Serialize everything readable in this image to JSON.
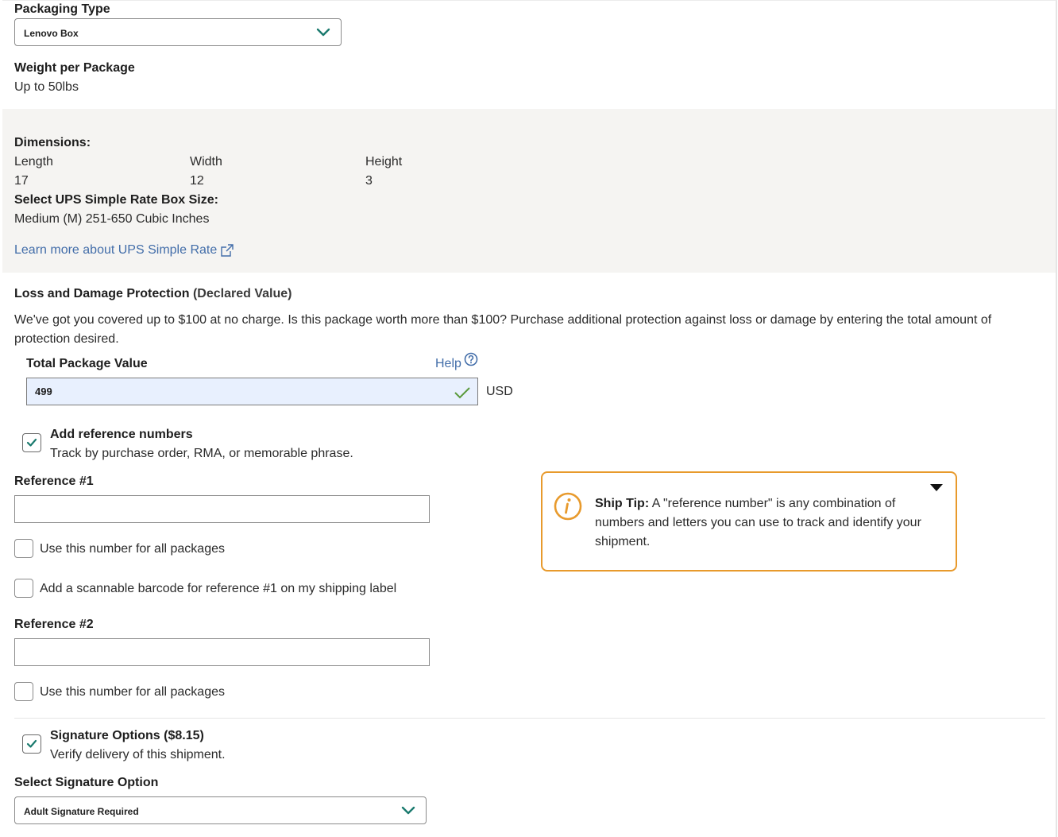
{
  "packaging": {
    "type_label": "Packaging Type",
    "type_value": "Lenovo Box",
    "weight_label": "Weight per Package",
    "weight_value": "Up to 50lbs"
  },
  "dimensions": {
    "title": "Dimensions:",
    "length_label": "Length",
    "length_value": "17",
    "width_label": "Width",
    "width_value": "12",
    "height_label": "Height",
    "height_value": "3",
    "box_size_label": "Select UPS Simple Rate Box Size:",
    "box_size_value": "Medium (M) 251-650 Cubic Inches",
    "learn_more_link": "Learn more about UPS Simple Rate"
  },
  "protection": {
    "title": "Loss and Damage Protection",
    "title_suffix": "(Declared Value)",
    "description": "We've got you covered up to $100 at no charge. Is this package worth more than $100? Purchase additional protection against loss or damage by entering the total amount of protection desired.",
    "value_label": "Total Package Value",
    "help_link": "Help",
    "value": "499",
    "currency": "USD"
  },
  "references": {
    "add_label": "Add reference numbers",
    "add_sublabel": "Track by purchase order, RMA, or memorable phrase.",
    "add_checked": true,
    "ref1_label": "Reference #1",
    "ref1_value": "",
    "ref1_all_packages": "Use this number for all packages",
    "ref1_barcode": "Add a scannable barcode for reference #1 on my shipping label",
    "ref2_label": "Reference #2",
    "ref2_value": "",
    "ref2_all_packages": "Use this number for all packages"
  },
  "ship_tip": {
    "heading": "Ship Tip:",
    "text": "A \"reference number\" is any combination of numbers and letters you can use to track and identify your shipment."
  },
  "signature": {
    "label": "Signature Options ($8.15)",
    "sublabel": "Verify delivery of this shipment.",
    "checked": true,
    "select_label": "Select Signature Option",
    "select_value": "Adult Signature Required"
  },
  "colors": {
    "accent_teal": "#1a7a6e",
    "link_blue": "#426da9",
    "tip_orange": "#e89a2c",
    "autofill_blue": "#e8f0fe"
  }
}
